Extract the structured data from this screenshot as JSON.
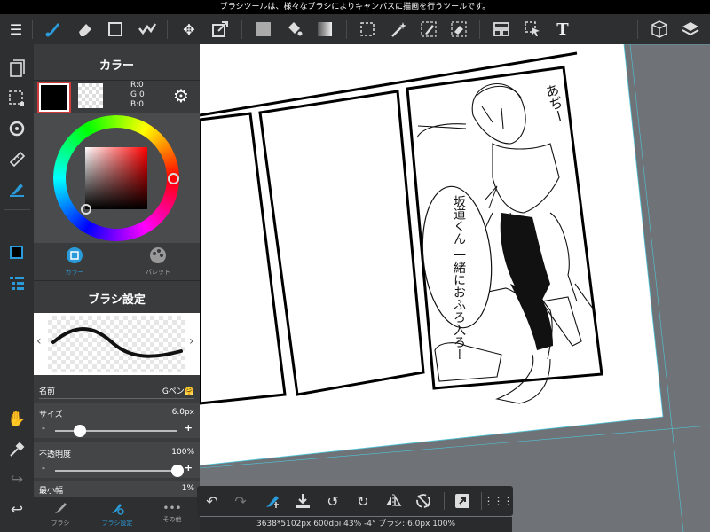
{
  "status_message": "ブラシツールは、様々なブラシによりキャンバスに描画を行うツールです。",
  "toolbar": {
    "icons": [
      "menu-icon",
      "brush-icon",
      "eraser-icon",
      "shape-icon",
      "correction-icon",
      "move-icon",
      "transform-icon",
      "fill-color-icon",
      "bucket-icon",
      "gradient-icon",
      "select-icon",
      "magic-wand-icon",
      "pen-select-icon",
      "eraser-select-icon",
      "layout-icon",
      "object-select-icon",
      "text-icon",
      "3d-icon",
      "layers-icon"
    ],
    "text_tool_glyph": "T"
  },
  "color_panel": {
    "title": "カラー",
    "rgb": {
      "r": "R:0",
      "g": "G:0",
      "b": "B:0"
    },
    "main_color": "#000000",
    "tab_color": "カラー",
    "tab_palette": "パレット"
  },
  "brush_panel": {
    "title": "ブラシ設定",
    "name_label": "名前",
    "name_value": "Gペン🤗",
    "size_label": "サイズ",
    "size_value": "6.0px",
    "size_fraction": 0.2,
    "opacity_label": "不透明度",
    "opacity_value": "100%",
    "opacity_fraction": 1.0,
    "min_width_label": "最小幅",
    "min_width_value": "1%",
    "minus": "-",
    "plus": "+"
  },
  "bottom_tabs": {
    "brush": "ブラシ",
    "brush_settings": "ブラシ設定",
    "other": "その他"
  },
  "canvas_info": "3638*5102px 600dpi 43% -4° ブラシ: 6.0px 100%",
  "manga": {
    "sfx_top": "あぢー",
    "speech": "坂道くん 一緒におふろ入ろー"
  },
  "accent_color": "#2a9bd8"
}
